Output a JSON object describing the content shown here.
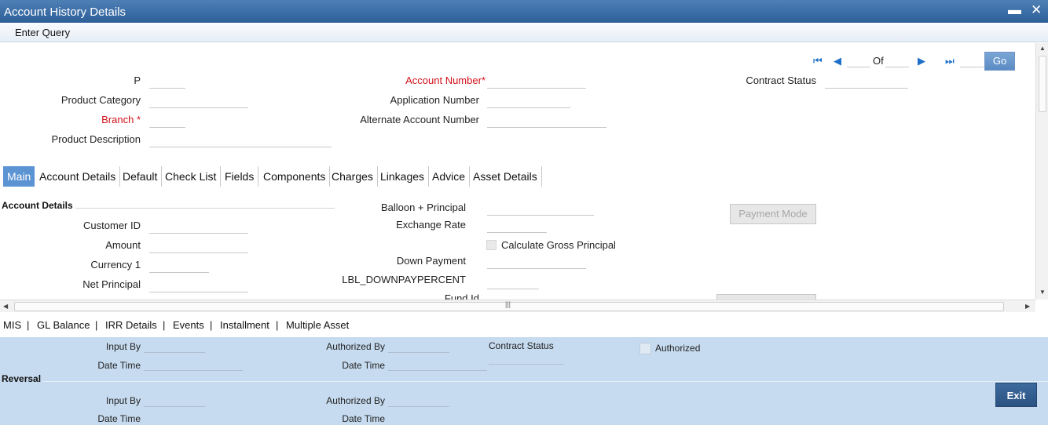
{
  "window": {
    "title": "Account History Details",
    "minimize": "▬",
    "close": "✕"
  },
  "menu": {
    "enter_query": "Enter Query"
  },
  "nav": {
    "first": "⏮",
    "prev": "◀",
    "of": "Of",
    "next": "▶",
    "last": "⏭",
    "go": "Go"
  },
  "header": {
    "p_label": "P",
    "product_category": "Product Category",
    "branch": "Branch",
    "product_description": "Product Description",
    "account_number": "Account Number",
    "application_number": "Application Number",
    "alternate_account_number": "Alternate Account Number",
    "contract_status": "Contract Status",
    "required_mark": "*"
  },
  "tabs": [
    "Main",
    "Account Details",
    "Default",
    "Check List",
    "Fields",
    "Components",
    "Charges",
    "Linkages",
    "Advice",
    "Asset Details"
  ],
  "main": {
    "section_title": "Account Details",
    "customer_id": "Customer ID",
    "amount": "Amount",
    "currency_1": "Currency 1",
    "net_principal": "Net Principal",
    "balloon_principal": "Balloon + Principal",
    "exchange_rate": "Exchange Rate",
    "calculate_gross_principal": "Calculate Gross Principal",
    "down_payment": "Down Payment",
    "downpay_percent": "LBL_DOWNPAYPERCENT",
    "fund_id": "Fund Id",
    "payment_mode_button": "Payment Mode"
  },
  "links": [
    "MIS",
    "GL Balance",
    "IRR Details",
    "Events",
    "Installment",
    "Multiple Asset"
  ],
  "link_separator": "|",
  "footer": {
    "input_by": "Input By",
    "date_time": "Date Time",
    "authorized_by": "Authorized By",
    "contract_status": "Contract Status",
    "authorized": "Authorized",
    "reversal_title": "Reversal",
    "exit": "Exit"
  },
  "colors": {
    "titlebar": "#2c5e99",
    "footer_bg": "#c6dbef",
    "required": "#d1111a",
    "active_tab": "#5b93d3"
  }
}
